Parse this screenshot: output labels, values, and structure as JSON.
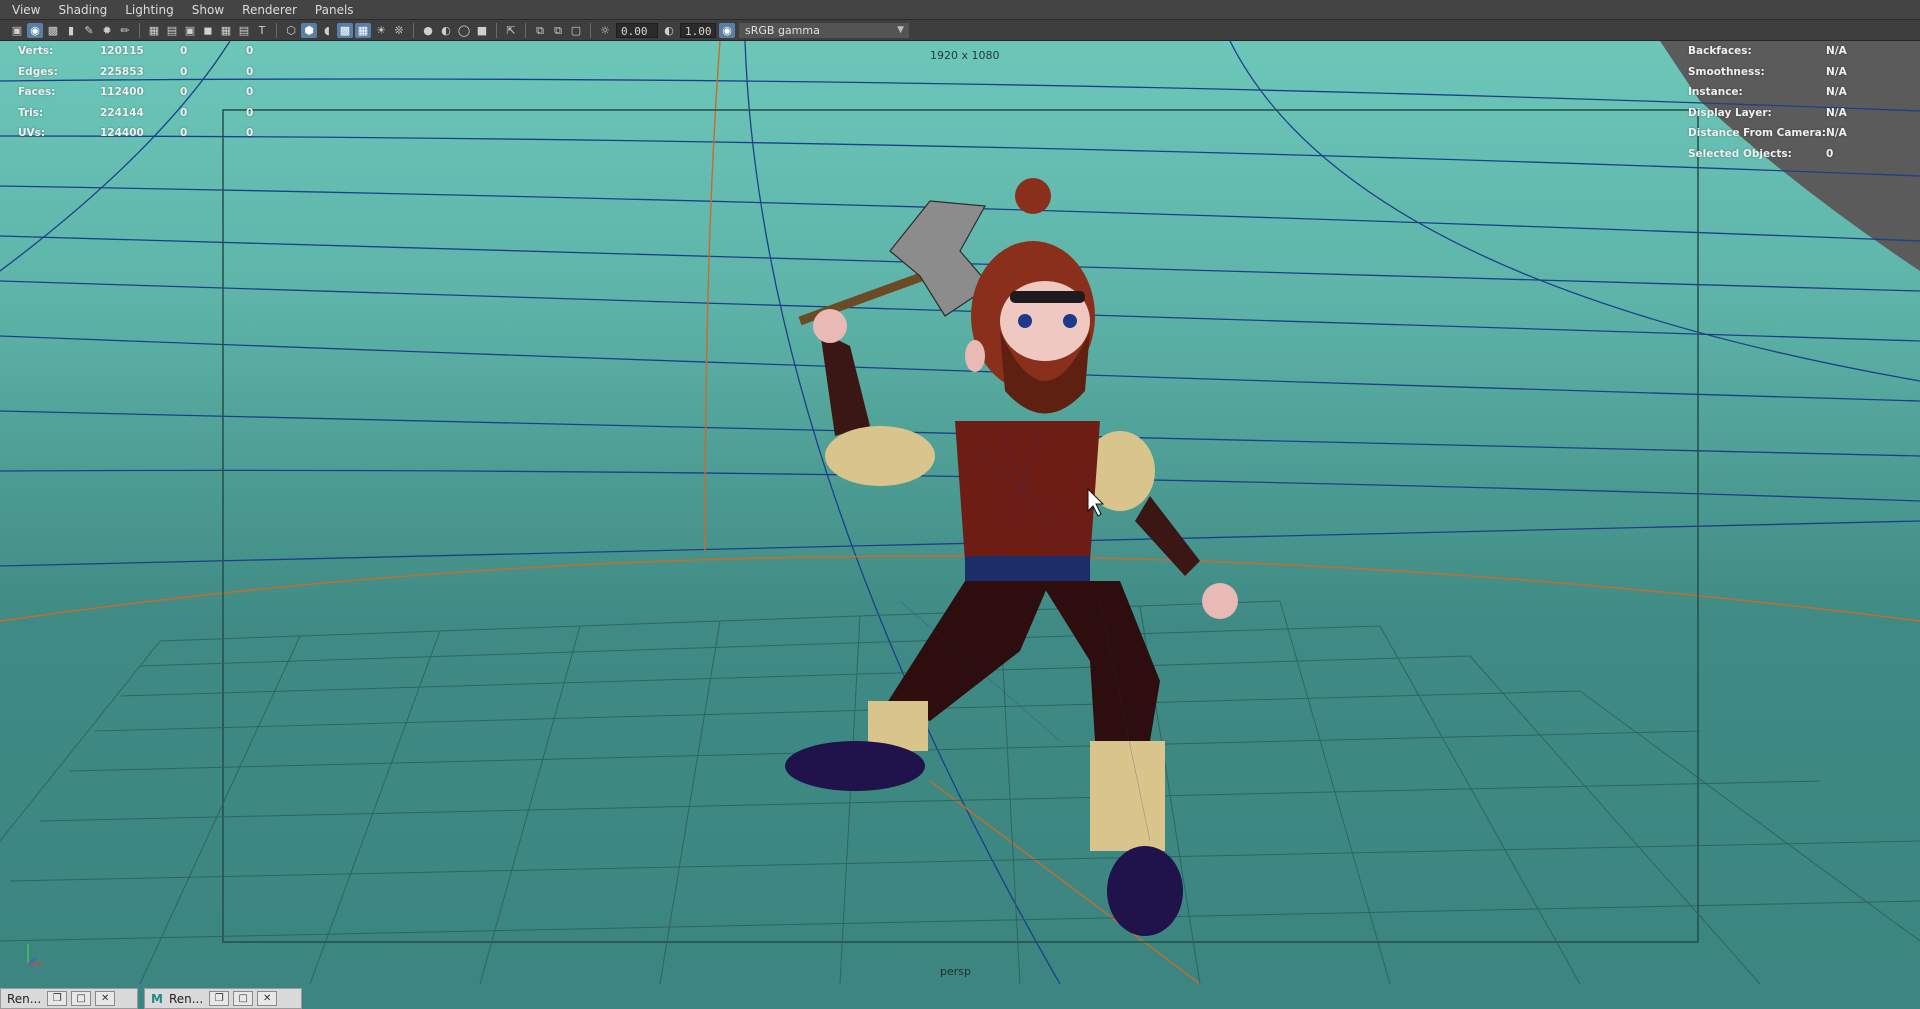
{
  "menubar": {
    "items": [
      {
        "label": "View"
      },
      {
        "label": "Shading"
      },
      {
        "label": "Lighting"
      },
      {
        "label": "Show"
      },
      {
        "label": "Renderer"
      },
      {
        "label": "Panels"
      }
    ]
  },
  "toolbar": {
    "exposure_value": "0.00",
    "gamma_value": "1.00",
    "color_space": "sRGB gamma",
    "icons": [
      "camera-icon",
      "select-camera-icon",
      "camera-attributes-icon",
      "bookmark-icon",
      "grease-pencil-icon",
      "image-plane-icon",
      "grid-icon",
      "film-gate-icon",
      "resolution-gate-icon",
      "gate-mask-icon",
      "field-chart-icon",
      "safe-action-icon",
      "safe-title-icon",
      "wireframe-icon",
      "smooth-shade-icon",
      "default-material-icon",
      "wireframe-on-shaded-icon",
      "xray-icon",
      "use-lights-icon",
      "shadows-icon",
      "screen-space-ao-icon",
      "motion-blur-icon",
      "multisample-aa-icon",
      "depth-of-field-icon",
      "isolate-select-icon",
      "xray-joints-icon",
      "xray-active-icon",
      "backface-cull-icon",
      "exposure-icon",
      "gamma-icon",
      "color-management-icon"
    ]
  },
  "hud_left": {
    "rows": [
      {
        "label": "Verts:",
        "v1": "120115",
        "v2": "0",
        "v3": "0"
      },
      {
        "label": "Edges:",
        "v1": "225853",
        "v2": "0",
        "v3": "0"
      },
      {
        "label": "Faces:",
        "v1": "112400",
        "v2": "0",
        "v3": "0"
      },
      {
        "label": "Tris:",
        "v1": "224144",
        "v2": "0",
        "v3": "0"
      },
      {
        "label": "UVs:",
        "v1": "124400",
        "v2": "0",
        "v3": "0"
      }
    ]
  },
  "hud_right": {
    "rows": [
      {
        "label": "Backfaces:",
        "value": "N/A"
      },
      {
        "label": "Smoothness:",
        "value": "N/A"
      },
      {
        "label": "Instance:",
        "value": "N/A"
      },
      {
        "label": "Display Layer:",
        "value": "N/A"
      },
      {
        "label": "Distance From Camera:",
        "value": "N/A"
      },
      {
        "label": "Selected Objects:",
        "value": "0"
      }
    ]
  },
  "viewport": {
    "resolution": "1920 x 1080",
    "camera": "persp",
    "axes": {
      "x": "x",
      "y": "y",
      "z": "z"
    }
  },
  "taskbar": {
    "items": [
      {
        "label": "Ren..."
      },
      {
        "label": "Ren..."
      }
    ]
  }
}
